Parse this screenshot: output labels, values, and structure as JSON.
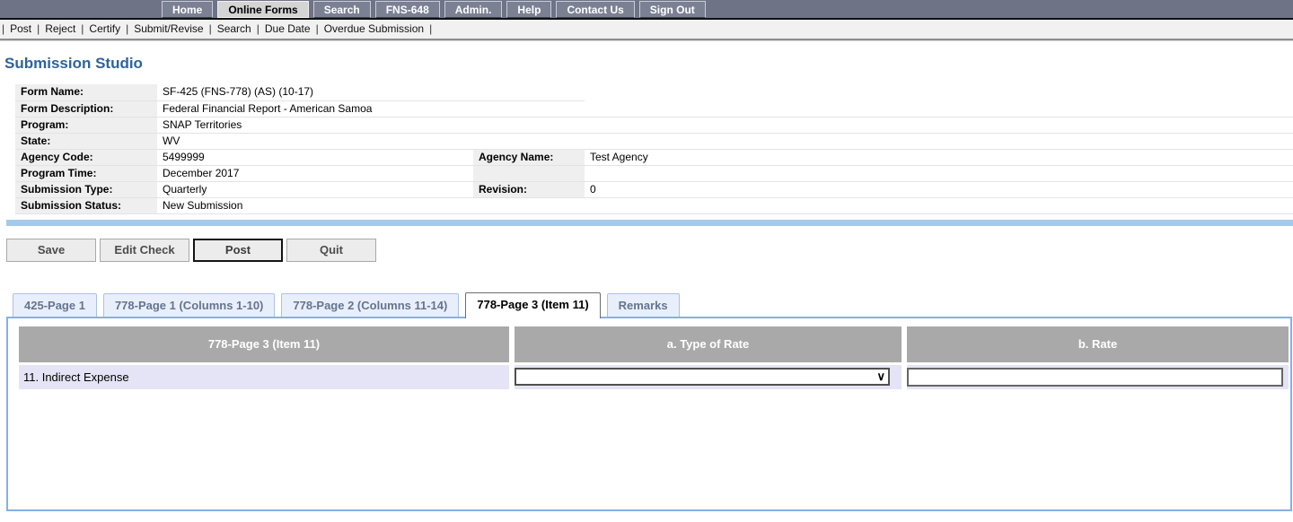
{
  "navbar": {
    "items": [
      {
        "label": "Home",
        "active": false
      },
      {
        "label": "Online Forms",
        "active": true
      },
      {
        "label": "Search",
        "active": false
      },
      {
        "label": "FNS-648",
        "active": false
      },
      {
        "label": "Admin.",
        "active": false
      },
      {
        "label": "Help",
        "active": false
      },
      {
        "label": "Contact Us",
        "active": false
      },
      {
        "label": "Sign Out",
        "active": false
      }
    ]
  },
  "menubar": {
    "separator": "|",
    "items": [
      {
        "label": "Post"
      },
      {
        "label": "Reject"
      },
      {
        "label": "Certify"
      },
      {
        "label": "Submit/Revise"
      },
      {
        "label": "Search"
      },
      {
        "label": "Due Date"
      },
      {
        "label": "Overdue Submission"
      }
    ]
  },
  "page": {
    "title": "Submission Studio"
  },
  "form_info": {
    "rows": [
      {
        "label": "Form Name:",
        "value": "SF-425 (FNS-778) (AS) (10-17)",
        "label2": "",
        "value2": ""
      },
      {
        "label": "Form Description:",
        "value": "Federal Financial Report - American Samoa",
        "label2": "",
        "value2": ""
      },
      {
        "label": "Program:",
        "value": "SNAP Territories",
        "label2": "",
        "value2": ""
      },
      {
        "label": "State:",
        "value": "WV",
        "label2": "",
        "value2": ""
      },
      {
        "label": "Agency Code:",
        "value": "5499999",
        "label2": "Agency Name:",
        "value2": "Test Agency"
      },
      {
        "label": "Program Time:",
        "value": "December 2017",
        "label2": "",
        "value2": ""
      },
      {
        "label": "Submission Type:",
        "value": "Quarterly",
        "label2": "Revision:",
        "value2": "0"
      },
      {
        "label": "Submission Status:",
        "value": "New Submission",
        "label2": "",
        "value2": ""
      }
    ]
  },
  "actions": {
    "save": "Save",
    "edit_check": "Edit Check",
    "post": "Post",
    "quit": "Quit"
  },
  "tabs": [
    {
      "label": "425-Page 1",
      "active": false
    },
    {
      "label": "778-Page 1 (Columns 1-10)",
      "active": false
    },
    {
      "label": "778-Page 2 (Columns 11-14)",
      "active": false
    },
    {
      "label": "778-Page 3 (Item 11)",
      "active": true
    },
    {
      "label": "Remarks",
      "active": false
    }
  ],
  "grid": {
    "headers": [
      "778-Page 3 (Item 11)",
      "a. Type of Rate",
      "b. Rate"
    ],
    "rows": [
      {
        "label": "11. Indirect Expense",
        "type_of_rate_selected": "",
        "rate_value": ""
      }
    ],
    "chevron_icon": "∨"
  },
  "colors": {
    "navbar_bg": "#6f7386",
    "nav_active_bg": "#d4d4d4",
    "title_blue": "#2d639c",
    "divider_blue": "#a5c9e8",
    "panel_border_blue": "#85b0e3",
    "grid_header_gray": "#a9a9a9",
    "grid_row_lavender": "#e4e4f6",
    "label_cell_gray": "#efefef"
  }
}
